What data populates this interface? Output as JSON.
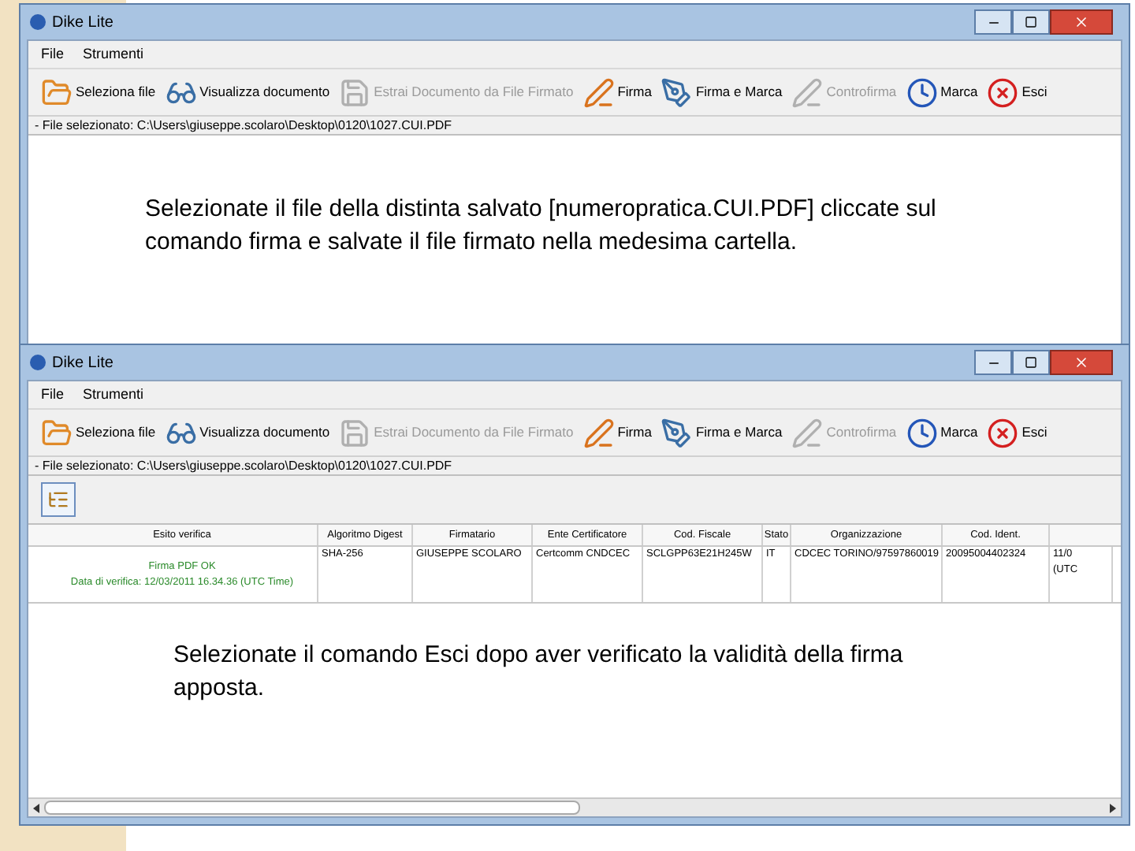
{
  "windows": [
    {
      "title": "Dike Lite",
      "menu": [
        "File",
        "Strumenti"
      ],
      "toolbar": [
        {
          "label": "Seleziona file",
          "disabled": false
        },
        {
          "label": "Visualizza documento",
          "disabled": false
        },
        {
          "label": "Estrai Documento da File Firmato",
          "disabled": true
        },
        {
          "label": "Firma",
          "disabled": false
        },
        {
          "label": "Firma e Marca",
          "disabled": false
        },
        {
          "label": "Controfirma",
          "disabled": true
        },
        {
          "label": "Marca",
          "disabled": false
        },
        {
          "label": "Esci",
          "disabled": false
        }
      ],
      "path": "- File selezionato: C:\\Users\\giuseppe.scolaro\\Desktop\\0120\\1027.CUI.PDF",
      "note": "Selezionate il file della distinta salvato [numeropratica.CUI.PDF] cliccate sul comando firma e salvate il file firmato nella medesima cartella."
    },
    {
      "title": "Dike Lite",
      "menu": [
        "File",
        "Strumenti"
      ],
      "toolbar": [
        {
          "label": "Seleziona file",
          "disabled": false
        },
        {
          "label": "Visualizza documento",
          "disabled": false
        },
        {
          "label": "Estrai Documento da File Firmato",
          "disabled": true
        },
        {
          "label": "Firma",
          "disabled": false
        },
        {
          "label": "Firma e Marca",
          "disabled": false
        },
        {
          "label": "Controfirma",
          "disabled": true
        },
        {
          "label": "Marca",
          "disabled": false
        },
        {
          "label": "Esci",
          "disabled": false
        }
      ],
      "path": "- File selezionato: C:\\Users\\giuseppe.scolaro\\Desktop\\0120\\1027.CUI.PDF",
      "table": {
        "columns": [
          "Esito verifica",
          "Algoritmo Digest",
          "Firmatario",
          "Ente Certificatore",
          "Cod. Fiscale",
          "Stato",
          "Organizzazione",
          "Cod. Ident."
        ],
        "rows": [
          {
            "cells": [
              [
                "Firma PDF OK",
                "Data di verifica: 12/03/2011 16.34.36 (UTC Time)"
              ],
              "SHA-256",
              "GIUSEPPE SCOLARO",
              "Certcomm CNDCEC",
              "SCLGPP63E21H245W",
              "IT",
              "CDCEC TORINO/97597860019",
              "20095004402324",
              [
                "11/0",
                "(UTC"
              ]
            ]
          }
        ]
      },
      "note": "Selezionate il comando Esci dopo aver verificato la validità della firma apposta."
    }
  ]
}
